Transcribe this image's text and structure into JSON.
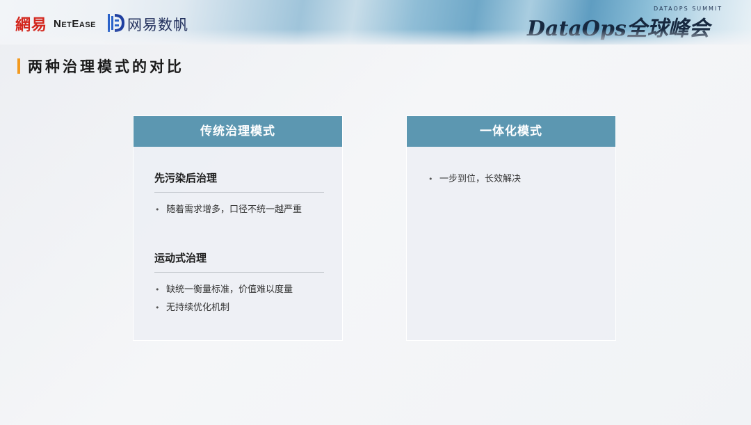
{
  "header": {
    "netease_cn": "網易",
    "netease_en": "NetEase",
    "shufan_logo": "网易数帆",
    "summit_small": "DATAOPS SUMMIT",
    "summit_title": "DataOps全球峰会"
  },
  "page": {
    "title": "两种治理模式的对比"
  },
  "cards": {
    "traditional": {
      "title": "传统治理模式",
      "sections": [
        {
          "title": "先污染后治理",
          "bullets": [
            "随着需求增多，口径不统一越严重"
          ]
        },
        {
          "title": "运动式治理",
          "bullets": [
            "缺统一衡量标准，价值难以度量",
            "无持续优化机制"
          ]
        }
      ]
    },
    "integrated": {
      "title": "一体化模式",
      "bullets": [
        "一步到位，长效解决"
      ]
    }
  },
  "colors": {
    "card_header": "#5c97b1",
    "accent_bar": "#f39a1f",
    "netease_red": "#d3261d",
    "shufan_blue": "#1f2d5a"
  }
}
